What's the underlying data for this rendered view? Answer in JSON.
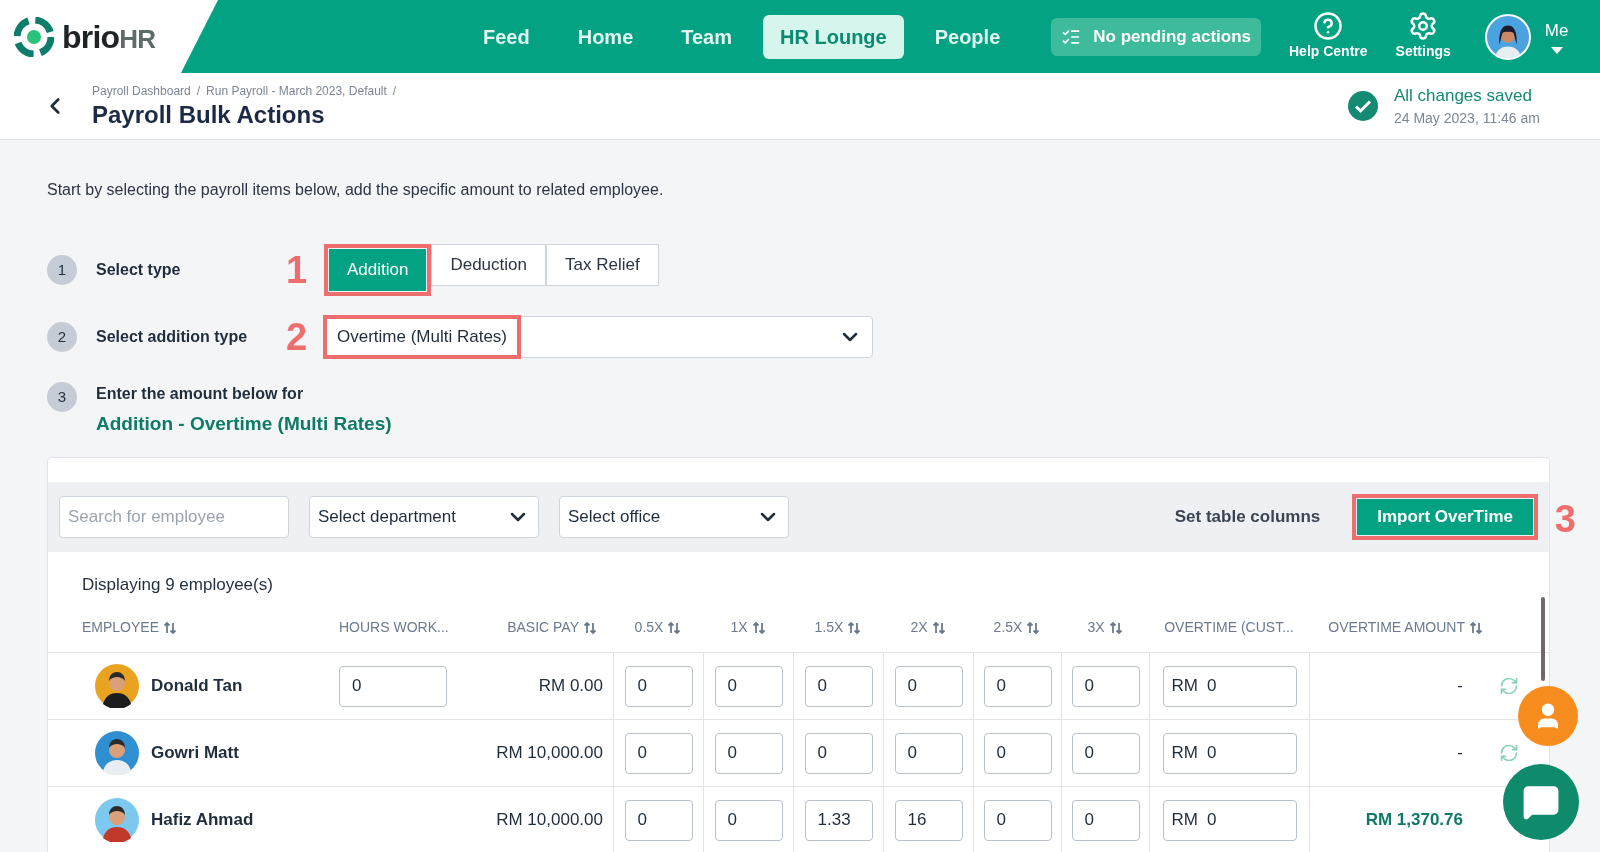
{
  "nav": {
    "brand": "brio",
    "brand_suffix": "HR",
    "items": [
      {
        "label": "Feed",
        "selected": false
      },
      {
        "label": "Home",
        "selected": false
      },
      {
        "label": "Team",
        "selected": false
      },
      {
        "label": "HR Lounge",
        "selected": true
      },
      {
        "label": "People",
        "selected": false
      }
    ],
    "pending_actions": "No pending actions",
    "help": "Help Centre",
    "settings": "Settings",
    "profile": "Me"
  },
  "header": {
    "separator": "/",
    "breadcrumbs": [
      "Payroll Dashboard",
      "Run Payroll - March 2023, Default"
    ],
    "title": "Payroll Bulk Actions",
    "save_status": "All changes saved",
    "saved_at": "24 May 2023, 11:46 am"
  },
  "intro": "Start by selecting the payroll items below, add the specific amount to related employee.",
  "steps": [
    {
      "number": "1",
      "label": "Select type",
      "annotation": "1",
      "options": [
        {
          "label": "Addition",
          "selected": true
        },
        {
          "label": "Deduction",
          "selected": false
        },
        {
          "label": "Tax Relief",
          "selected": false
        }
      ]
    },
    {
      "number": "2",
      "label": "Select addition type",
      "annotation": "2",
      "value": "Overtime (Multi Rates)"
    },
    {
      "number": "3",
      "label": "Enter the amount below for",
      "subtitle": "Addition - Overtime (Multi Rates)"
    }
  ],
  "filters": {
    "search_placeholder": "Search for employee",
    "department_placeholder": "Select department",
    "office_placeholder": "Select office",
    "set_columns": "Set table columns",
    "import_button": "Import OverTime",
    "import_annotation": "3"
  },
  "table": {
    "count": "Displaying 9 employee(s)",
    "columns": [
      {
        "label": "EMPLOYEE",
        "sortable": true
      },
      {
        "label": "HOURS WORK...",
        "sortable": false
      },
      {
        "label": "BASIC PAY",
        "sortable": true
      },
      {
        "label": "0.5X",
        "sortable": true
      },
      {
        "label": "1X",
        "sortable": true
      },
      {
        "label": "1.5X",
        "sortable": true
      },
      {
        "label": "2X",
        "sortable": true
      },
      {
        "label": "2.5X",
        "sortable": true
      },
      {
        "label": "3X",
        "sortable": true
      },
      {
        "label": "OVERTIME (CUST...",
        "sortable": false
      },
      {
        "label": "OVERTIME AMOUNT",
        "sortable": true
      }
    ],
    "rows": [
      {
        "name": "Donald Tan",
        "hours": "0",
        "basic_pay": "RM 0.00",
        "rates": [
          "0",
          "0",
          "0",
          "0",
          "0",
          "0"
        ],
        "custom_prefix": "RM",
        "custom": "0",
        "amount": "-",
        "amount_highlight": false,
        "refresh": true
      },
      {
        "name": "Gowri Matt",
        "basic_pay": "RM 10,000.00",
        "rates": [
          "0",
          "0",
          "0",
          "0",
          "0",
          "0"
        ],
        "custom_prefix": "RM",
        "custom": "0",
        "amount": "-",
        "amount_highlight": false,
        "refresh": true
      },
      {
        "name": "Hafiz Ahmad",
        "basic_pay": "RM 10,000.00",
        "rates": [
          "0",
          "0",
          "1.33",
          "16",
          "0",
          "0"
        ],
        "custom_prefix": "RM",
        "custom": "0",
        "amount": "RM 1,370.76",
        "amount_highlight": true,
        "refresh": false
      }
    ]
  }
}
